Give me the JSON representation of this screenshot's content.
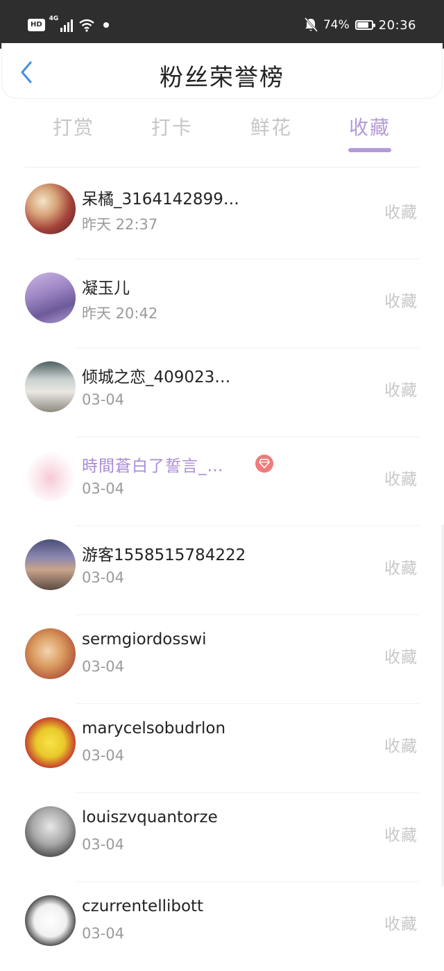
{
  "status_bar": {
    "hd": "HD",
    "network": "4G",
    "battery": "74%",
    "battery_level": 0.74,
    "time": "20:36",
    "icons": [
      "hd-icon",
      "signal-icon",
      "wifi-icon",
      "notification-dot-icon",
      "mute-bell-icon",
      "battery-icon"
    ]
  },
  "header": {
    "title": "粉丝荣誉榜",
    "back_icon": "chevron-left-icon",
    "accent_color": "#4a90e2"
  },
  "tabs": [
    {
      "label": "打赏",
      "active": false
    },
    {
      "label": "打卡",
      "active": false
    },
    {
      "label": "鲜花",
      "active": false
    },
    {
      "label": "收藏",
      "active": true
    }
  ],
  "active_color": "#b49ad8",
  "list": [
    {
      "name": "呆橘_3164142899…",
      "time": "昨天 22:37",
      "action": "收藏",
      "avatar": "anime-illustration-avatar",
      "vip": false
    },
    {
      "name": "凝玉儿",
      "time": "昨天 20:42",
      "action": "收藏",
      "avatar": "purple-sky-avatar",
      "vip": false
    },
    {
      "name": "倾城之恋_409023…",
      "time": "03-04",
      "action": "收藏",
      "avatar": "anime-girl-avatar",
      "vip": false
    },
    {
      "name": "時間蒼白了誓言_…",
      "time": "03-04",
      "action": "收藏",
      "avatar": "pink-blossom-avatar",
      "vip": true,
      "badge_icon": "diamond-icon"
    },
    {
      "name": "游客1558515784222",
      "time": "03-04",
      "action": "收藏",
      "avatar": "city-bridge-avatar",
      "vip": false
    },
    {
      "name": "sermgiordosswi",
      "time": "03-04",
      "action": "收藏",
      "avatar": "dog-avatar",
      "vip": false
    },
    {
      "name": "marycelsobudrlon",
      "time": "03-04",
      "action": "收藏",
      "avatar": "spongebob-avatar",
      "vip": false
    },
    {
      "name": "louiszvquantorze",
      "time": "03-04",
      "action": "收藏",
      "avatar": "child-portrait-avatar",
      "vip": false
    },
    {
      "name": "czurrentellibott",
      "time": "03-04",
      "action": "收藏",
      "avatar": "meme-face-avatar",
      "vip": false
    }
  ]
}
